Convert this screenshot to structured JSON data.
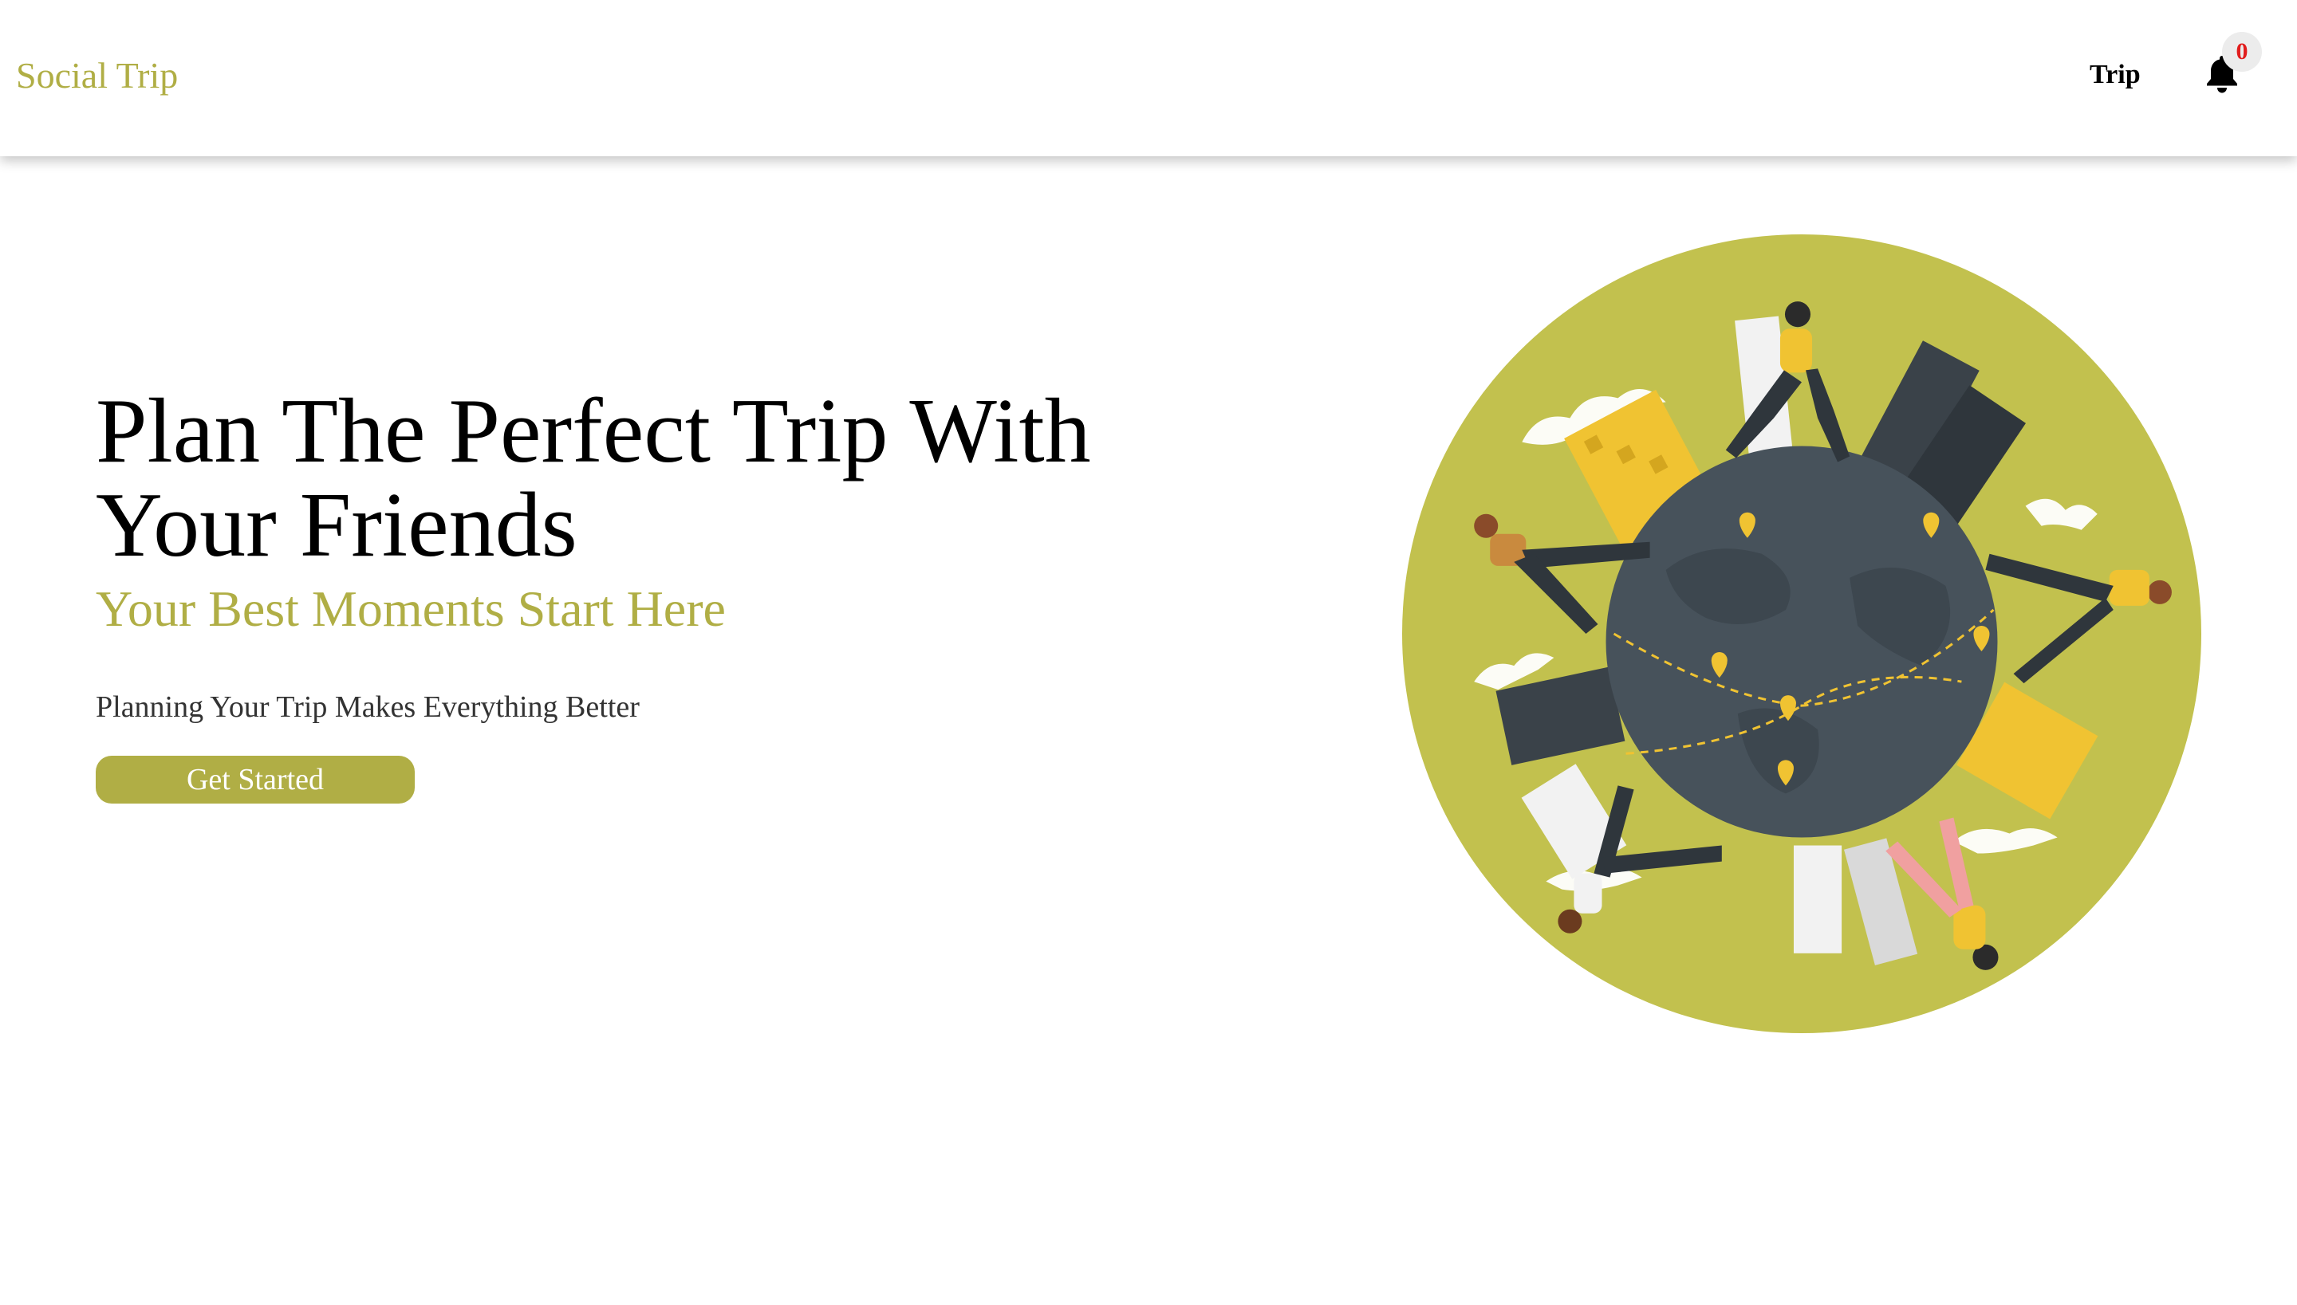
{
  "navbar": {
    "brand": "Social Trip",
    "trip_label": "Trip",
    "bell_icon": "bell-icon",
    "notification_count": "0"
  },
  "hero": {
    "title": "Plan The Perfect Trip With Your Friends",
    "subtitle": "Your Best Moments Start Here",
    "tagline": "Planning Your Trip Makes Everything Better",
    "cta_label": "Get Started",
    "illustration": "globe-travelers-illustration"
  },
  "colors": {
    "accent": "#b0ae45",
    "illustration_circle": "#c2c14e",
    "globe": "#47525b",
    "yellow": "#f0c332",
    "badge_text": "#e11d1d"
  }
}
